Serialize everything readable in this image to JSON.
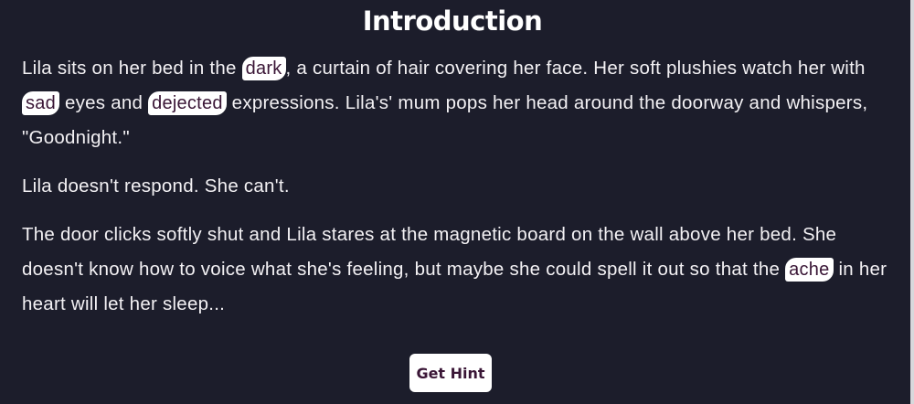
{
  "title": "Introduction",
  "paragraphs": [
    {
      "s1": "Lila sits on her bed in the ",
      "w1": "dark",
      "s2": ", a curtain of hair covering her face. Her soft plushies watch her with ",
      "w2": "sad",
      "s3": " eyes and ",
      "w3": "dejected",
      "s4": " expressions. Lila's' mum pops her head around the doorway and whispers, \"Goodnight.\""
    },
    {
      "s1": "Lila doesn't respond. She can't."
    },
    {
      "s1": "The door clicks softly shut and Lila stares at the magnetic board on the wall above her bed. She doesn't know how to voice what she's feeling, but maybe she could spell it out so that the ",
      "w1": "ache",
      "s2": " in her heart will let her sleep..."
    }
  ],
  "hint_button": "Get Hint",
  "colors": {
    "background": "#1c1d2b",
    "text": "#f3f1f4",
    "word_bg": "#ffffff",
    "word_text": "#3a1636"
  }
}
